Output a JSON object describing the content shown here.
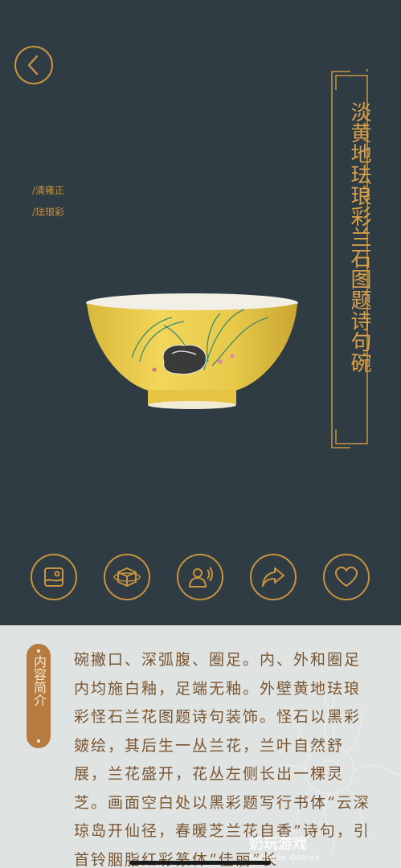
{
  "header": {
    "back_icon": "chevron-left-icon"
  },
  "artifact": {
    "dynasty": "/清雍正",
    "category": "/珐琅彩",
    "title": "淡黄地珐琅彩兰石图题诗句碗"
  },
  "actions": [
    {
      "icon": "image-icon"
    },
    {
      "icon": "3d-cube-icon"
    },
    {
      "icon": "audio-guide-icon"
    },
    {
      "icon": "share-icon"
    },
    {
      "icon": "heart-icon"
    }
  ],
  "intro": {
    "tag_label": "内容简介",
    "text": "碗撇口、深弧腹、圈足。内、外和圈足内均施白釉，足端无釉。外壁黄地珐琅彩怪石兰花图题诗句装饰。怪石以黑彩皴绘，其后生一丛兰花，兰叶自然舒展，兰花盛开，花丛左侧长出一棵灵芝。画面空白处以黑彩题写行书体“云深琼岛开仙径，春暖芝兰花自香”诗句，引首铃胭脂红彩篆体“佳丽”长"
  },
  "watermark": {
    "cn": "奶玩游戏",
    "en": "Nainwan Games"
  },
  "colors": {
    "background": "#2f3c43",
    "accent": "#c9933f",
    "panel": "#dfe3e2",
    "tag": "#b77b3f",
    "text": "#7a5531"
  }
}
